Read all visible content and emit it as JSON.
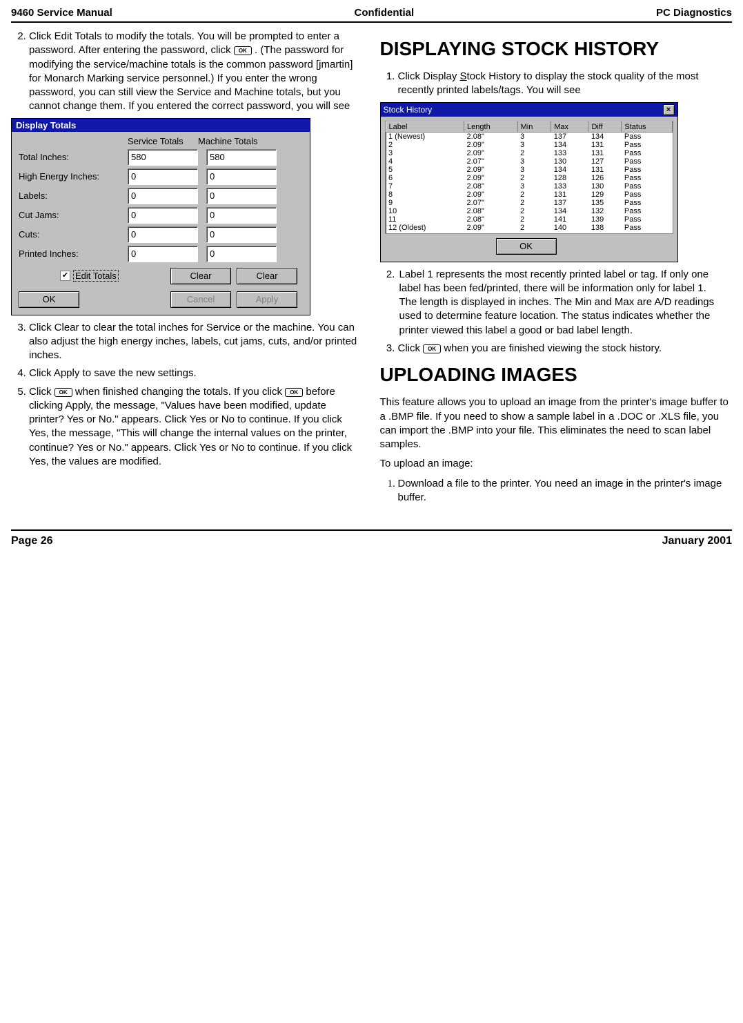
{
  "header": {
    "left": "9460 Service Manual",
    "center": "Confidential",
    "right": "PC Diagnostics"
  },
  "footer": {
    "left": "Page 26",
    "right": "January 2001"
  },
  "left_items": {
    "2": "Click Edit Totals to modify the totals.  You will be prompted to enter a password.  After entering the password, click ",
    "2b": ".  (The password for modifying the service/machine totals is the common password [jmartin] for Monarch Marking service personnel.)  If you enter the wrong password, you can still view the Service and Machine totals, but you cannot change them.  If you entered the correct password, you will see",
    "3": "Click Clear to clear the total inches for Service or the machine.  You can also adjust the high energy inches, labels, cut jams, cuts, and/or printed inches.",
    "4": "Click Apply to save the new settings.",
    "5a": "Click ",
    "5b": " when finished changing the totals.  If you click ",
    "5c": " before clicking Apply, the message, \"Values have been modified, update printer?  Yes or No.\" appears.  Click Yes or No to continue.  If you click Yes, the message, \"This will change the internal values on the printer, continue?  Yes or No.\" appears.  Click Yes or No to continue.  If you click Yes, the values are modified."
  },
  "totals_dialog": {
    "title": "Display Totals",
    "service_hdr": "Service Totals",
    "machine_hdr": "Machine Totals",
    "rows": [
      {
        "label": "Total Inches:",
        "svc": "580",
        "mach": "580"
      },
      {
        "label": "High Energy Inches:",
        "svc": "0",
        "mach": "0"
      },
      {
        "label": "Labels:",
        "svc": "0",
        "mach": "0"
      },
      {
        "label": "Cut Jams:",
        "svc": "0",
        "mach": "0"
      },
      {
        "label": "Cuts:",
        "svc": "0",
        "mach": "0"
      },
      {
        "label": "Printed Inches:",
        "svc": "0",
        "mach": "0"
      }
    ],
    "edit_lbl": "Edit Totals",
    "clear_lbl": "Clear",
    "ok_lbl": "OK",
    "cancel_lbl": "Cancel",
    "apply_lbl": "Apply"
  },
  "right": {
    "h1": "DISPLAYING STOCK HISTORY",
    "item1a": "Click Display ",
    "item1b": "tock History to display the stock quality of the most recently printed labels/tags.  You will see",
    "s_underlined": "S",
    "item2": "Label 1 represents the most recently printed label or tag.  If only one label has been fed/printed, there will be information only for label 1.",
    "item2b": "The length is displayed in inches.  The Min and Max are A/D readings used to determine feature location.  The status indicates whether the printer viewed this label a good or bad label length.",
    "item3a": "Click ",
    "item3b": " when you are finished viewing the stock history.",
    "h2": "UPLOADING IMAGES",
    "p1": "This feature allows you to upload an image from the printer's image buffer to a .BMP file.  If you need to show a sample label in a .DOC or .XLS file, you can import the .BMP into your file.  This eliminates the need to scan label samples.",
    "p2": "To upload an image:",
    "u1": "Download a file to the printer.  You need an image in the printer's image buffer."
  },
  "stock_dialog": {
    "title": "Stock History",
    "headers": [
      "Label",
      "Length",
      "Min",
      "Max",
      "Diff",
      "Status"
    ],
    "rows": [
      [
        "1 (Newest)",
        "2.08\"",
        "3",
        "137",
        "134",
        "Pass"
      ],
      [
        "2",
        "2.09\"",
        "3",
        "134",
        "131",
        "Pass"
      ],
      [
        "3",
        "2.09\"",
        "2",
        "133",
        "131",
        "Pass"
      ],
      [
        "4",
        "2.07\"",
        "3",
        "130",
        "127",
        "Pass"
      ],
      [
        "5",
        "2.09\"",
        "3",
        "134",
        "131",
        "Pass"
      ],
      [
        "6",
        "2.09\"",
        "2",
        "128",
        "126",
        "Pass"
      ],
      [
        "7",
        "2.08\"",
        "3",
        "133",
        "130",
        "Pass"
      ],
      [
        "8",
        "2.09\"",
        "2",
        "131",
        "129",
        "Pass"
      ],
      [
        "9",
        "2.07\"",
        "2",
        "137",
        "135",
        "Pass"
      ],
      [
        "10",
        "2.08\"",
        "2",
        "134",
        "132",
        "Pass"
      ],
      [
        "11",
        "2.08\"",
        "2",
        "141",
        "139",
        "Pass"
      ],
      [
        "12 (Oldest)",
        "2.09\"",
        "2",
        "140",
        "138",
        "Pass"
      ]
    ],
    "ok_lbl": "OK"
  },
  "ok_glyph": "OK",
  "chart_data": {
    "type": "table",
    "title": "Stock History",
    "columns": [
      "Label",
      "Length",
      "Min",
      "Max",
      "Diff",
      "Status"
    ],
    "rows": [
      [
        "1 (Newest)",
        "2.08\"",
        3,
        137,
        134,
        "Pass"
      ],
      [
        "2",
        "2.09\"",
        3,
        134,
        131,
        "Pass"
      ],
      [
        "3",
        "2.09\"",
        2,
        133,
        131,
        "Pass"
      ],
      [
        "4",
        "2.07\"",
        3,
        130,
        127,
        "Pass"
      ],
      [
        "5",
        "2.09\"",
        3,
        134,
        131,
        "Pass"
      ],
      [
        "6",
        "2.09\"",
        2,
        128,
        126,
        "Pass"
      ],
      [
        "7",
        "2.08\"",
        3,
        133,
        130,
        "Pass"
      ],
      [
        "8",
        "2.09\"",
        2,
        131,
        129,
        "Pass"
      ],
      [
        "9",
        "2.07\"",
        2,
        137,
        135,
        "Pass"
      ],
      [
        "10",
        "2.08\"",
        2,
        134,
        132,
        "Pass"
      ],
      [
        "11",
        "2.08\"",
        2,
        141,
        139,
        "Pass"
      ],
      [
        "12 (Oldest)",
        "2.09\"",
        2,
        140,
        138,
        "Pass"
      ]
    ]
  }
}
